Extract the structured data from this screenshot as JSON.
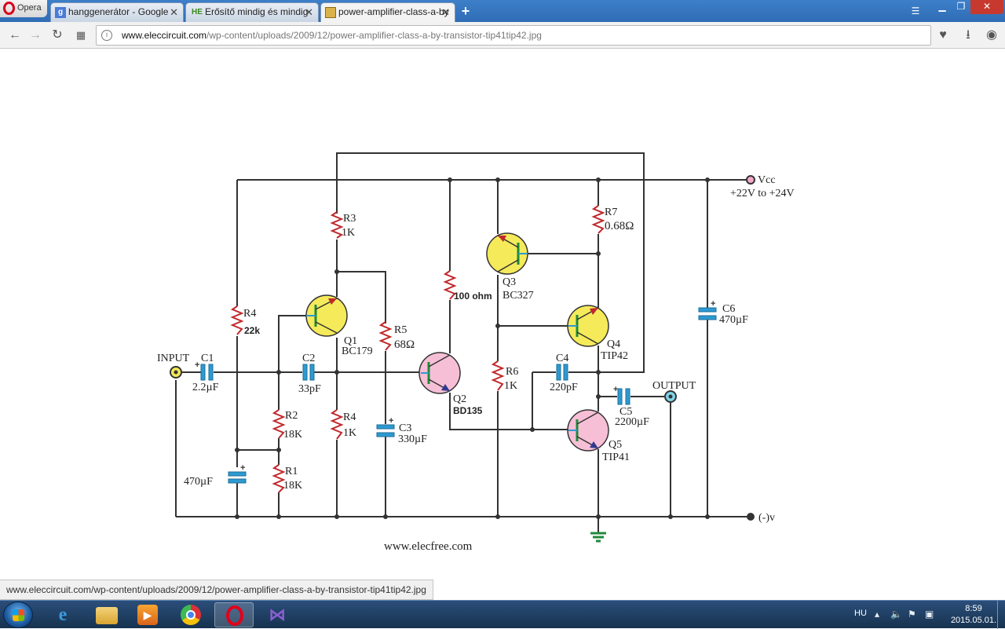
{
  "browser": {
    "menu_label": "Opera",
    "tabs": [
      {
        "favicon": "g",
        "label": "hanggenerátor - Google"
      },
      {
        "favicon": "HE",
        "label": "Erősítő mindig és mindig"
      },
      {
        "favicon": "img",
        "label": "power-amplifier-class-a-by"
      }
    ],
    "new_tab": "+",
    "url_domain": "www.eleccircuit.com",
    "url_path": "/wp-content/uploads/2009/12/power-amplifier-class-a-by-transistor-tip41tip42.jpg",
    "status_url": "www.eleccircuit.com/wp-content/uploads/2009/12/power-amplifier-class-a-by-transistor-tip41tip42.jpg"
  },
  "schematic": {
    "vcc_label": "Vcc",
    "vcc_range": "+22V to +24V",
    "ground_label": "(-)v",
    "input_label": "INPUT",
    "output_label": "OUTPUT",
    "watermark": "www.elecfree.com",
    "components": {
      "c1": {
        "name": "C1",
        "value": "2.2µF"
      },
      "c2": {
        "name": "C2",
        "value": "33pF"
      },
      "c3": {
        "name": "C3",
        "value": "330µF"
      },
      "c4": {
        "name": "C4",
        "value": "220pF"
      },
      "c5": {
        "name": "C5",
        "value": "2200µF"
      },
      "c6": {
        "name": "C6",
        "value": "470µF"
      },
      "c_bias": {
        "value": "470µF"
      },
      "r1": {
        "name": "R1",
        "value": "18K"
      },
      "r2": {
        "name": "R2",
        "value": "18K"
      },
      "r3": {
        "name": "R3",
        "value": "1K"
      },
      "r4a": {
        "name": "R4",
        "value": "22k"
      },
      "r4b": {
        "name": "R4",
        "value": "1K"
      },
      "r5": {
        "name": "R5",
        "value": "68Ω"
      },
      "r6": {
        "name": "R6",
        "value": "1K"
      },
      "r7": {
        "name": "R7",
        "value": "0.68Ω"
      },
      "r100": {
        "value": "100 ohm"
      },
      "q1": {
        "name": "Q1",
        "value": "BC179"
      },
      "q2": {
        "name": "Q2",
        "value": "BD135"
      },
      "q3": {
        "name": "Q3",
        "value": "BC327"
      },
      "q4": {
        "name": "Q4",
        "value": "TIP42"
      },
      "q5": {
        "name": "Q5",
        "value": "TIP41"
      }
    }
  },
  "taskbar": {
    "language": "HU",
    "time": "8:59",
    "date": "2015.05.01."
  }
}
